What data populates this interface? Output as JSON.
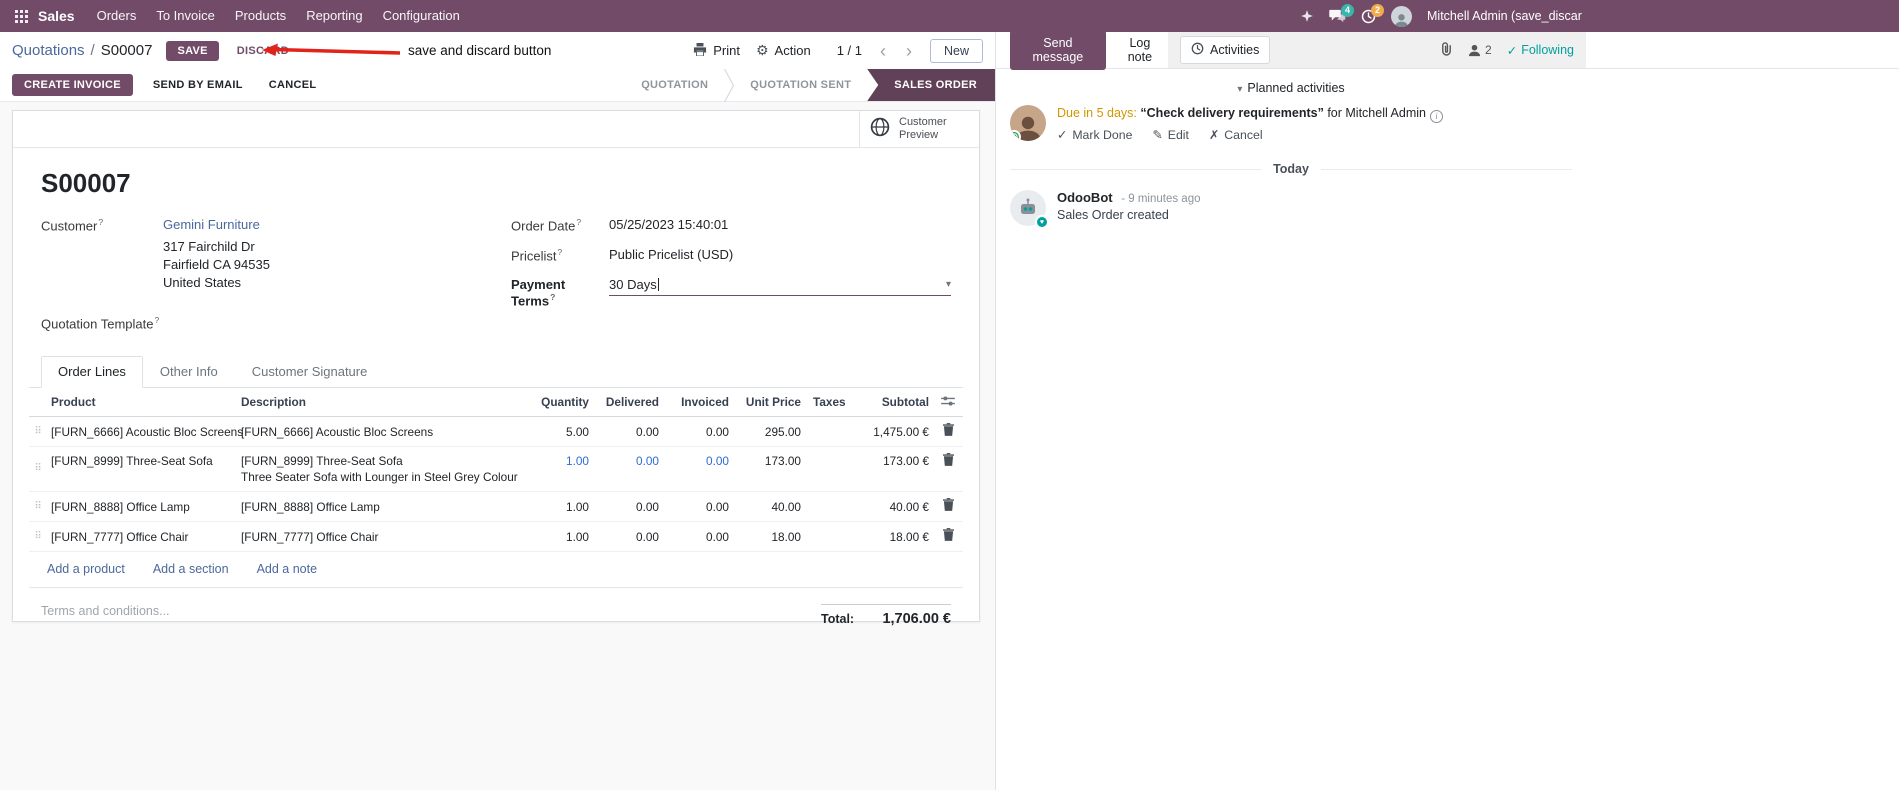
{
  "colors": {
    "brand": "#714B67",
    "stage_active": "#614158",
    "link": "#4a699b",
    "edited_value": "#2d6cd2",
    "activity_due": "#cf9700",
    "following_teal": "#00a09d",
    "badge_messages": "#3bb5ac",
    "badge_activities": "#f0ad4e",
    "annotation_red": "#e2231a"
  },
  "icons": {
    "prev": "‹",
    "next": "›",
    "gear": "⚙",
    "caret_down": "▾",
    "check": "✓",
    "pencil": "✎",
    "cross": "✗",
    "drag_handle": "⠿",
    "info": "i",
    "help": "?",
    "heart": "♥"
  },
  "topbar": {
    "brand": "Sales",
    "menus": [
      "Orders",
      "To Invoice",
      "Products",
      "Reporting",
      "Configuration"
    ],
    "messages_badge": "4",
    "activities_badge": "2",
    "user_name": "Mitchell Admin (save_discar"
  },
  "control_panel": {
    "breadcrumb_parent": "Quotations",
    "breadcrumb_separator": "/",
    "breadcrumb_current": "S00007",
    "save": "SAVE",
    "discard": "DISCARD",
    "annotation": "save and discard button",
    "print": "Print",
    "action": "Action",
    "pager": "1 / 1",
    "new": "New"
  },
  "statusbar": {
    "create_invoice": "CREATE INVOICE",
    "send_by_email": "SEND BY EMAIL",
    "cancel": "CANCEL",
    "stages": [
      "QUOTATION",
      "QUOTATION SENT",
      "SALES ORDER"
    ],
    "active_stage": "SALES ORDER"
  },
  "sheet": {
    "customer_preview": "Customer Preview",
    "title": "S00007",
    "customer_label": "Customer",
    "customer_name": "Gemini Furniture",
    "address": [
      "317 Fairchild Dr",
      "Fairfield CA 94535",
      "United States"
    ],
    "quotation_template_label": "Quotation Template",
    "order_date_label": "Order Date",
    "order_date": "05/25/2023 15:40:01",
    "pricelist_label": "Pricelist",
    "pricelist": "Public Pricelist (USD)",
    "payment_terms_label": "Payment Terms",
    "payment_terms": "30 Days",
    "tabs": [
      "Order Lines",
      "Other Info",
      "Customer Signature"
    ],
    "columns": {
      "product": "Product",
      "description": "Description",
      "quantity": "Quantity",
      "delivered": "Delivered",
      "invoiced": "Invoiced",
      "unit_price": "Unit Price",
      "taxes": "Taxes",
      "subtotal": "Subtotal"
    },
    "rows": [
      {
        "product": "[FURN_6666] Acoustic Bloc Screens",
        "description": "[FURN_6666] Acoustic Bloc Screens",
        "description2": "",
        "quantity": "5.00",
        "delivered": "0.00",
        "invoiced": "0.00",
        "unit_price": "295.00",
        "taxes": "",
        "subtotal": "1,475.00 €"
      },
      {
        "product": "[FURN_8999] Three-Seat Sofa",
        "description": "[FURN_8999] Three-Seat Sofa",
        "description2": "Three Seater Sofa with Lounger in Steel Grey Colour",
        "quantity": "1.00",
        "delivered": "0.00",
        "invoiced": "0.00",
        "unit_price": "173.00",
        "taxes": "",
        "subtotal": "173.00 €"
      },
      {
        "product": "[FURN_8888] Office Lamp",
        "description": "[FURN_8888] Office Lamp",
        "description2": "",
        "quantity": "1.00",
        "delivered": "0.00",
        "invoiced": "0.00",
        "unit_price": "40.00",
        "taxes": "",
        "subtotal": "40.00 €"
      },
      {
        "product": "[FURN_7777] Office Chair",
        "description": "[FURN_7777] Office Chair",
        "description2": "",
        "quantity": "1.00",
        "delivered": "0.00",
        "invoiced": "0.00",
        "unit_price": "18.00",
        "taxes": "",
        "subtotal": "18.00 €"
      }
    ],
    "add_product": "Add a product",
    "add_section": "Add a section",
    "add_note": "Add a note",
    "terms_placeholder": "Terms and conditions...",
    "total_label": "Total:",
    "total_value": "1,706.00 €"
  },
  "chatter": {
    "send_message": "Send message",
    "log_note": "Log note",
    "activities_tab": "Activities",
    "followers_count": "2",
    "following": "Following",
    "planned_header": "Planned activities",
    "activity_due": "Due in 5 days:",
    "activity_summary": "“Check delivery requirements”",
    "activity_for": "for Mitchell Admin",
    "mark_done": "Mark Done",
    "edit": "Edit",
    "cancel": "Cancel",
    "date_divider": "Today",
    "author": "OdooBot",
    "time": "- 9 minutes ago",
    "body": "Sales Order created"
  }
}
